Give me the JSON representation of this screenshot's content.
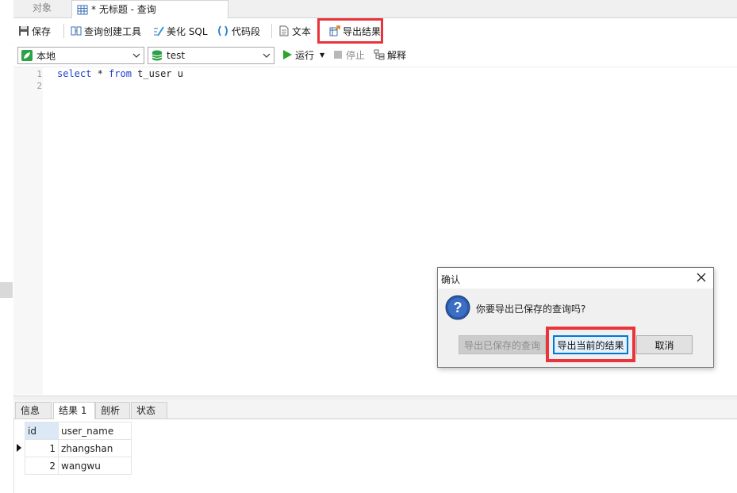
{
  "tabs": {
    "objects": "对象",
    "query": "* 无标题 - 查询"
  },
  "toolbar": {
    "save": "保存",
    "query_builder": "查询创建工具",
    "beautify_sql": "美化 SQL",
    "code_snippet": "代码段",
    "text": "文本",
    "export_result": "导出结果"
  },
  "toolbar2": {
    "connection": "本地",
    "database": "test",
    "run": "运行",
    "stop": "停止",
    "explain": "解释"
  },
  "editor": {
    "lines": [
      "1",
      "2"
    ],
    "sql_keyword_select": "select",
    "sql_star": " * ",
    "sql_keyword_from": "from",
    "sql_rest": " t_user u"
  },
  "results": {
    "tabs": [
      "信息",
      "结果 1",
      "剖析",
      "状态"
    ],
    "columns": [
      "id",
      "user_name"
    ],
    "rows": [
      {
        "id": "1",
        "user_name": "zhangshan"
      },
      {
        "id": "2",
        "user_name": "wangwu"
      }
    ]
  },
  "dialog": {
    "title": "确认",
    "message": "你要导出已保存的查询吗?",
    "btn_saved": "导出已保存的查询",
    "btn_current": "导出当前的结果",
    "btn_cancel": "取消"
  },
  "colors": {
    "highlight": "#e8343a",
    "keyword": "#1f3fd0",
    "run_green": "#2aa52a"
  }
}
